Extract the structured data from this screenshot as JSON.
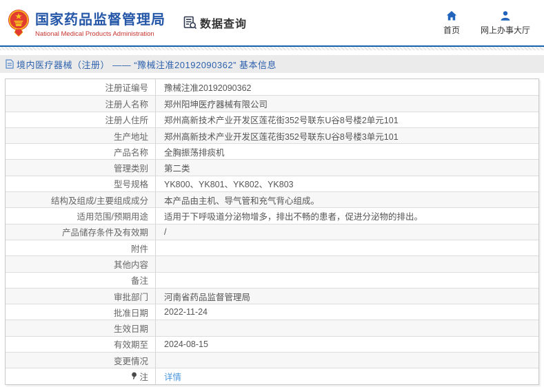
{
  "colors": {
    "brand-blue": "#2456a8",
    "brand-red": "#c7342f",
    "accent-blue": "#1661ac",
    "nav-icon-blue": "#2264bb",
    "title-blue": "#2e62ad",
    "link-blue": "#4a97dd",
    "row-alt": "#f7f7f8",
    "text-dark": "#333333",
    "text-label": "#666666",
    "text-value": "#555555",
    "table-border": "#c9c9c9",
    "row-border": "#dcdcdc"
  },
  "header": {
    "agency_cn": "国家药品监督管理局",
    "agency_en": "National Medical Products Administration",
    "section_label": "数据查询",
    "nav": [
      {
        "label": "首页",
        "icon": "home-icon"
      },
      {
        "label": "网上办事大厅",
        "icon": "user-icon"
      }
    ]
  },
  "title_bar": {
    "text": "境内医疗器械（注册） —— “豫械注准20192090362” 基本信息"
  },
  "table": {
    "rows": [
      {
        "label": "注册证编号",
        "value": "豫械注准20192090362"
      },
      {
        "label": "注册人名称",
        "value": "郑州阳坤医疗器械有限公司"
      },
      {
        "label": "注册人住所",
        "value": "郑州高新技术产业开发区莲花街352号联东U谷8号楼2单元101"
      },
      {
        "label": "生产地址",
        "value": "郑州高新技术产业开发区莲花街352号联东U谷8号楼3单元101"
      },
      {
        "label": "产品名称",
        "value": "全胸振荡排痰机"
      },
      {
        "label": "管理类别",
        "value": "第二类"
      },
      {
        "label": "型号规格",
        "value": "YK800、YK801、YK802、YK803"
      },
      {
        "label": "结构及组成/主要组成成分",
        "value": "本产品由主机、导气管和充气背心组成。"
      },
      {
        "label": "适用范围/预期用途",
        "value": "适用于下呼吸道分泌物增多，排出不畅的患者，促进分泌物的排出。"
      },
      {
        "label": "产品储存条件及有效期",
        "value": "/"
      },
      {
        "label": "附件",
        "value": ""
      },
      {
        "label": "其他内容",
        "value": ""
      },
      {
        "label": "备注",
        "value": ""
      },
      {
        "label": "审批部门",
        "value": "河南省药品监督管理局"
      },
      {
        "label": "批准日期",
        "value": "2022-11-24"
      },
      {
        "label": "生效日期",
        "value": ""
      },
      {
        "label": "有效期至",
        "value": "2024-08-15"
      },
      {
        "label": "变更情况",
        "value": ""
      },
      {
        "label": "注",
        "value": "详情",
        "icon": "pin",
        "link": true
      }
    ]
  }
}
